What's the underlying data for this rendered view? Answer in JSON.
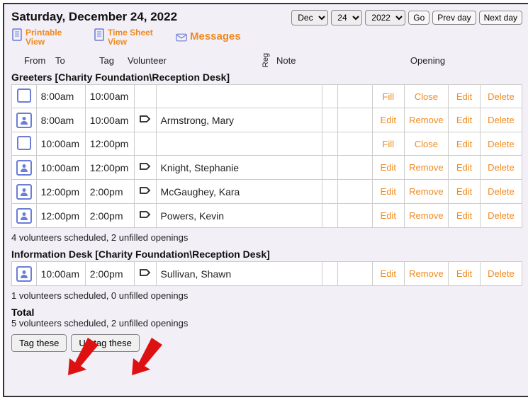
{
  "header": {
    "date_title": "Saturday, December 24, 2022",
    "month_select": "Dec",
    "day_select": "24",
    "year_select": "2022",
    "go_label": "Go",
    "prev_label": "Prev day",
    "next_label": "Next day"
  },
  "toolbar": {
    "printable_view": "Printable View",
    "timesheet_view": "Time Sheet View",
    "messages": "Messages"
  },
  "columns": {
    "from": "From",
    "to": "To",
    "tag": "Tag",
    "volunteer": "Volunteer",
    "reg": "Reg",
    "note": "Note",
    "opening": "Opening"
  },
  "groups": [
    {
      "title": "Greeters [Charity Foundation\\Reception Desk]",
      "rows": [
        {
          "filled": false,
          "from": "8:00am",
          "to": "10:00am",
          "volunteer": "",
          "a1": "Fill",
          "a2": "Close",
          "a3": "Edit",
          "a4": "Delete"
        },
        {
          "filled": true,
          "from": "8:00am",
          "to": "10:00am",
          "volunteer": "Armstrong, Mary",
          "a1": "Edit",
          "a2": "Remove",
          "a3": "Edit",
          "a4": "Delete"
        },
        {
          "filled": false,
          "from": "10:00am",
          "to": "12:00pm",
          "volunteer": "",
          "a1": "Fill",
          "a2": "Close",
          "a3": "Edit",
          "a4": "Delete"
        },
        {
          "filled": true,
          "from": "10:00am",
          "to": "12:00pm",
          "volunteer": "Knight, Stephanie",
          "a1": "Edit",
          "a2": "Remove",
          "a3": "Edit",
          "a4": "Delete"
        },
        {
          "filled": true,
          "from": "12:00pm",
          "to": "2:00pm",
          "volunteer": "McGaughey, Kara",
          "a1": "Edit",
          "a2": "Remove",
          "a3": "Edit",
          "a4": "Delete"
        },
        {
          "filled": true,
          "from": "12:00pm",
          "to": "2:00pm",
          "volunteer": "Powers, Kevin",
          "a1": "Edit",
          "a2": "Remove",
          "a3": "Edit",
          "a4": "Delete"
        }
      ],
      "summary": "4 volunteers scheduled, 2 unfilled openings"
    },
    {
      "title": "Information Desk [Charity Foundation\\Reception Desk]",
      "rows": [
        {
          "filled": true,
          "from": "10:00am",
          "to": "2:00pm",
          "volunteer": "Sullivan, Shawn",
          "a1": "Edit",
          "a2": "Remove",
          "a3": "Edit",
          "a4": "Delete"
        }
      ],
      "summary": "1 volunteers scheduled, 0 unfilled openings"
    }
  ],
  "total": {
    "label": "Total",
    "summary": "5 volunteers scheduled, 2 unfilled openings"
  },
  "buttons": {
    "tag": "Tag these",
    "untag": "Un-tag these"
  }
}
